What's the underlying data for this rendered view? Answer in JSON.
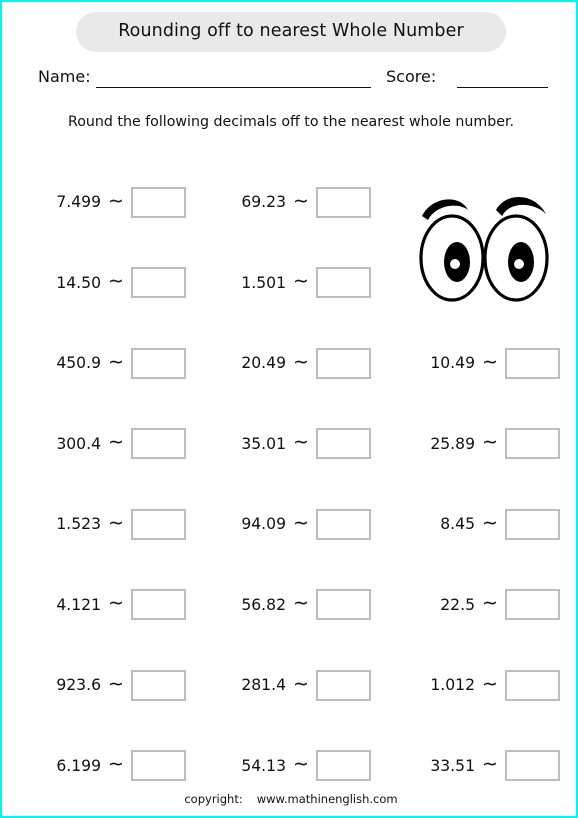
{
  "page": {
    "border_color": "#00f5f5",
    "background": "#ffffff"
  },
  "title": {
    "text": "Rounding off to nearest Whole Number",
    "pill_color": "#e9e9e9"
  },
  "fields": {
    "name_label": "Name:",
    "score_label": "Score:"
  },
  "instruction": {
    "text": "Round the following decimals off to the nearest whole number."
  },
  "symbols": {
    "approx": "∼"
  },
  "problems": {
    "columns": 3,
    "rows": [
      {
        "col0": "7.499",
        "col1": "69.23",
        "col2": null
      },
      {
        "col0": "14.50",
        "col1": "1.501",
        "col2": null
      },
      {
        "col0": "450.9",
        "col1": "20.49",
        "col2": "10.49"
      },
      {
        "col0": "300.4",
        "col1": "35.01",
        "col2": "25.89"
      },
      {
        "col0": "1.523",
        "col1": "94.09",
        "col2": "8.45"
      },
      {
        "col0": "4.121",
        "col1": "56.82",
        "col2": "22.5"
      },
      {
        "col0": "923.6",
        "col1": "281.4",
        "col2": "1.012"
      },
      {
        "col0": "6.199",
        "col1": "54.13",
        "col2": "33.51"
      }
    ]
  },
  "graphic": {
    "name": "cartoon-eyes",
    "description": "Pair of cartoon eyes with eyebrows"
  },
  "footer": {
    "copyright_label": "copyright:",
    "website": "www.mathinenglish.com"
  }
}
